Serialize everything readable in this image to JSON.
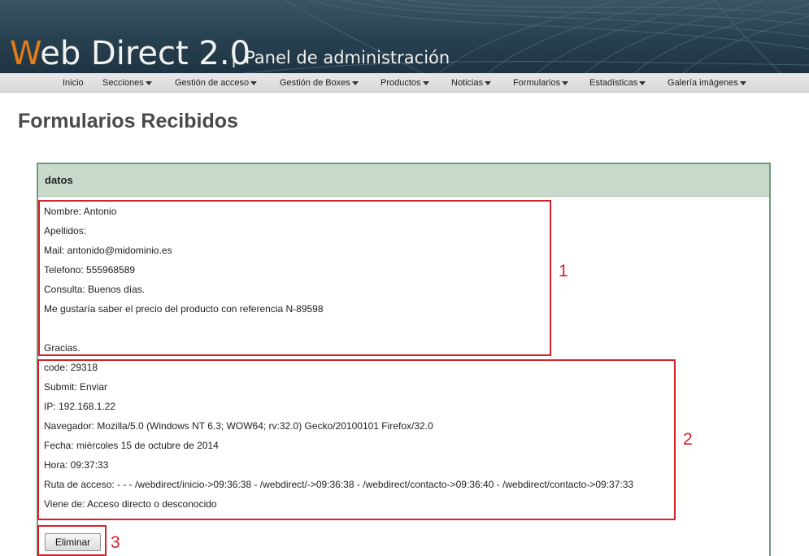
{
  "header": {
    "logo_initial": "W",
    "logo_rest": "eb Direct 2.0",
    "separator": "|",
    "panel_title": "Panel de administración"
  },
  "nav": {
    "items": [
      {
        "label": "Inicio",
        "has_dropdown": false
      },
      {
        "label": "Secciones",
        "has_dropdown": true
      },
      {
        "label": "Gestión de acceso",
        "has_dropdown": true
      },
      {
        "label": "Gestión de Boxes",
        "has_dropdown": true
      },
      {
        "label": "Productos",
        "has_dropdown": true
      },
      {
        "label": "Noticias",
        "has_dropdown": true
      },
      {
        "label": "Formularios",
        "has_dropdown": true
      },
      {
        "label": "Estadísticas",
        "has_dropdown": true
      },
      {
        "label": "Galería imágenes",
        "has_dropdown": true
      }
    ]
  },
  "page": {
    "title": "Formularios Recibidos"
  },
  "panel": {
    "header": "datos",
    "form_fields": [
      "Nombre: Antonio",
      "Apellidos:",
      "Mail: antonido@midominio.es",
      "Telefono: 555968589",
      "Consulta: Buenos días.",
      "Me gustaría saber el precio del producto con referencia N-89598",
      "",
      "Gracias."
    ],
    "meta_fields": [
      "code: 29318",
      "Submit: Enviar",
      "IP: 192.168.1.22",
      "Navegador: Mozilla/5.0 (Windows NT 6.3; WOW64; rv:32.0) Gecko/20100101 Firefox/32.0",
      "Fecha: miércoles 15 de octubre de 2014",
      "Hora: 09:37:33",
      "Ruta de acceso: - - - /webdirect/inicio->09:36:38 - /webdirect/->09:36:38 - /webdirect/contacto->09:36:40 - /webdirect/contacto->09:37:33",
      "Viene de: Acceso directo o desconocido"
    ],
    "delete_button": "Eliminar"
  },
  "annotations": {
    "markers": [
      "1",
      "2",
      "3"
    ],
    "color": "#d6202a"
  },
  "colors": {
    "logo_accent": "#e57c1a",
    "panel_border": "#6e9a7c",
    "panel_header_bg": "#c9dacd"
  }
}
